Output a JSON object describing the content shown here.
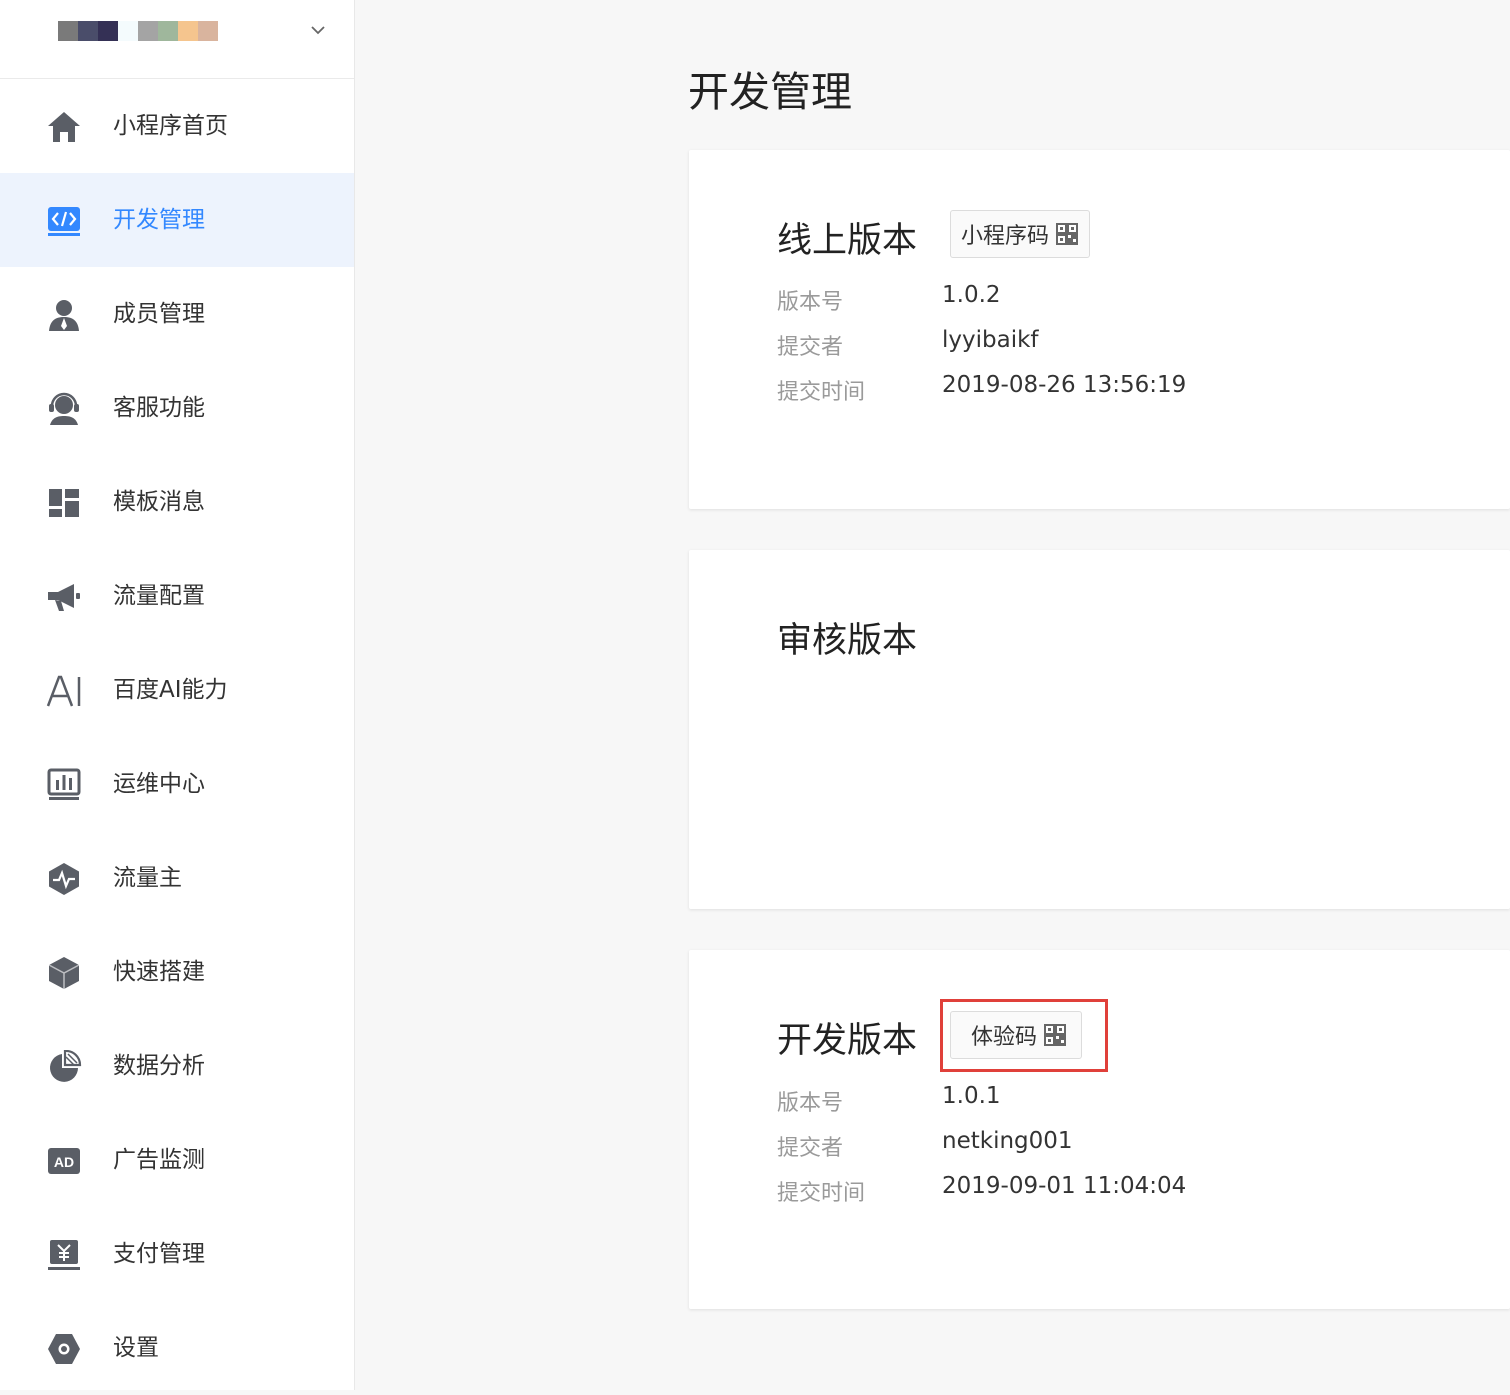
{
  "sidebar": {
    "brand_colors": [
      "#7a7a7a",
      "#4a4d6a",
      "#343055",
      "#f4fbfd",
      "#a4a4a4",
      "#9fb79c",
      "#f5c58e",
      "#d9b49e"
    ],
    "items": [
      {
        "label": "小程序首页",
        "icon": "home-icon"
      },
      {
        "label": "开发管理",
        "icon": "code-icon",
        "active": true
      },
      {
        "label": "成员管理",
        "icon": "user-icon"
      },
      {
        "label": "客服功能",
        "icon": "headset-icon"
      },
      {
        "label": "模板消息",
        "icon": "template-icon"
      },
      {
        "label": "流量配置",
        "icon": "megaphone-icon"
      },
      {
        "label": "百度AI能力",
        "icon": "ai-icon"
      },
      {
        "label": "运维中心",
        "icon": "bar-chart-icon"
      },
      {
        "label": "流量主",
        "icon": "pulse-icon"
      },
      {
        "label": "快速搭建",
        "icon": "cube-icon"
      },
      {
        "label": "数据分析",
        "icon": "pie-chart-icon"
      },
      {
        "label": "广告监测",
        "icon": "ad-icon"
      },
      {
        "label": "支付管理",
        "icon": "payment-icon"
      },
      {
        "label": "设置",
        "icon": "settings-icon"
      }
    ]
  },
  "main": {
    "title": "开发管理",
    "online": {
      "title": "线上版本",
      "qr_button": "小程序码",
      "fields": [
        {
          "label": "版本号",
          "value": "1.0.2"
        },
        {
          "label": "提交者",
          "value": "lyyibaikf"
        },
        {
          "label": "提交时间",
          "value": "2019-08-26 13:56:19"
        }
      ]
    },
    "review": {
      "title": "审核版本"
    },
    "dev": {
      "title": "开发版本",
      "qr_button": "体验码",
      "fields": [
        {
          "label": "版本号",
          "value": "1.0.1"
        },
        {
          "label": "提交者",
          "value": "netking001"
        },
        {
          "label": "提交时间",
          "value": "2019-09-01 11:04:04"
        }
      ]
    }
  },
  "colors": {
    "accent": "#3388ff",
    "active_bg": "#edf3fd",
    "icon_gray": "#5a5e66",
    "highlight": "#e0403a"
  }
}
